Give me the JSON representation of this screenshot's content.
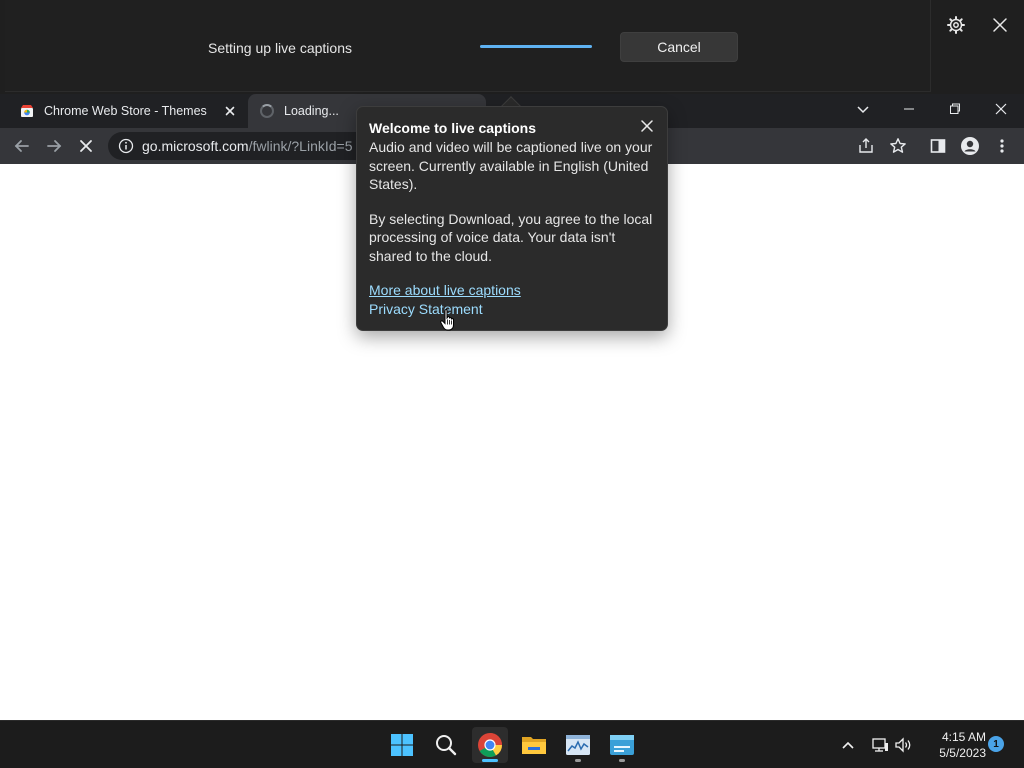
{
  "live_captions": {
    "status_text": "Setting up live captions",
    "cancel_label": "Cancel",
    "progress": 0.6,
    "accent_color": "#5fb2f2"
  },
  "browser": {
    "tabs": [
      {
        "title": "Chrome Web Store - Themes",
        "icon": "chrome-web-store-icon"
      },
      {
        "title": "Loading...",
        "icon": "loading-spinner"
      }
    ],
    "address": {
      "host": "go.microsoft.com",
      "path": "/fwlink/?LinkId=5"
    }
  },
  "popup": {
    "title": "Welcome to live captions",
    "body_1": "Audio and video will be captioned live on your screen. Currently available in English (United States).",
    "body_2": "By selecting Download, you agree to the local processing of voice data. Your data isn't shared to the cloud.",
    "link_more": "More about live captions",
    "link_privacy": "Privacy Statement",
    "link_color": "#9cdcfe"
  },
  "taskbar": {
    "pinned": [
      "start-icon",
      "search-icon",
      "chrome-icon",
      "file-explorer-icon",
      "task-manager-icon",
      "live-captions-icon"
    ],
    "clock_time": "4:15 AM",
    "clock_date": "5/5/2023",
    "notification_count": "1"
  }
}
